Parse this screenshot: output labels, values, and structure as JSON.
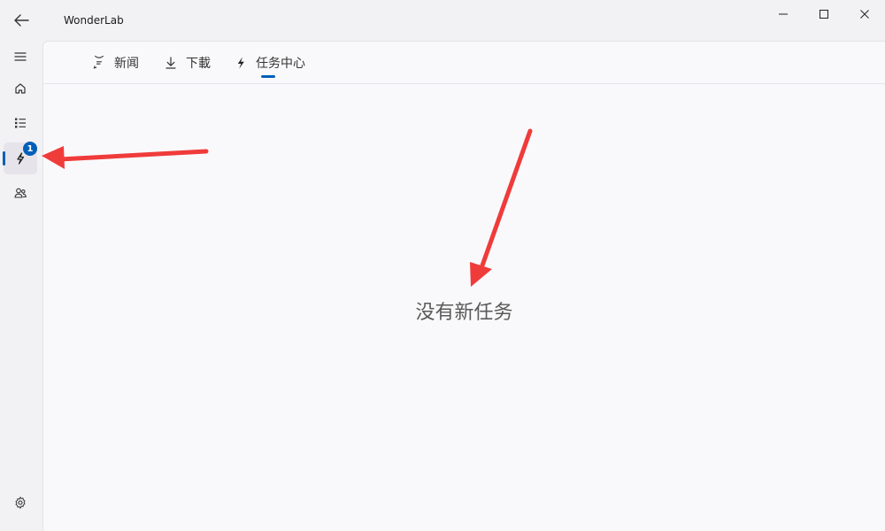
{
  "window": {
    "title": "WonderLab"
  },
  "tabs": [
    {
      "label": "新闻",
      "icon": "chat-icon"
    },
    {
      "label": "下載",
      "icon": "download-icon"
    },
    {
      "label": "任务中心",
      "icon": "lightning-icon",
      "selected": true
    }
  ],
  "nav": {
    "items": [
      {
        "name": "menu",
        "icon": "hamburger-icon"
      },
      {
        "name": "home",
        "icon": "home-icon"
      },
      {
        "name": "list",
        "icon": "list-icon"
      },
      {
        "name": "tasks",
        "icon": "lightning-icon",
        "selected": true,
        "badge": "1"
      },
      {
        "name": "accounts",
        "icon": "people-icon"
      },
      {
        "name": "settings",
        "icon": "gear-icon"
      }
    ],
    "badge_count": "1"
  },
  "main": {
    "empty_text": "没有新任务"
  },
  "colors": {
    "accent": "#005fb8",
    "annotation": "#f03b3b"
  }
}
